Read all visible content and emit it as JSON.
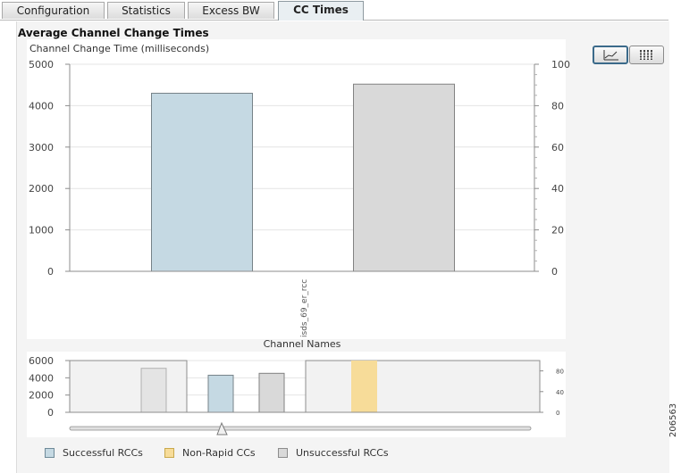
{
  "tabs": [
    {
      "label": "Configuration"
    },
    {
      "label": "Statistics"
    },
    {
      "label": "Excess BW"
    },
    {
      "label": "CC Times"
    }
  ],
  "page_title": "Average Channel Change Times",
  "view_toggle": {
    "icons": [
      "line-chart-icon",
      "column-chart-icon"
    ],
    "selected": "line-chart-icon"
  },
  "colors": {
    "successful": "#c5d9e3",
    "non_rapid": "#f7dc99",
    "unsuccessful": "#d9d9d9",
    "axis": "#8c8c8c"
  },
  "figure_number": "206563",
  "chart_data": [
    {
      "type": "bar",
      "ylabel": "Channel Change Time (milliseconds)",
      "xlabel": "Channel Names",
      "categories": [
        "isds_69_er_rcc"
      ],
      "series": [
        {
          "name": "Successful RCCs",
          "values": [
            4300
          ],
          "color": "#c5d9e3"
        },
        {
          "name": "Unsuccessful RCCs",
          "values": [
            4520
          ],
          "color": "#d9d9d9"
        }
      ],
      "ylim": [
        0,
        5000
      ],
      "yticks": [
        "0",
        "1000",
        "2000",
        "3000",
        "4000",
        "5000"
      ],
      "y2lim": [
        0,
        100
      ],
      "y2ticks": [
        "0",
        "20",
        "40",
        "60",
        "80",
        "100"
      ],
      "grid": true
    },
    {
      "type": "bar",
      "role": "overview navigator",
      "series": [
        {
          "name": "Unsuccessful RCCs",
          "values": [
            5100
          ],
          "color": "#d9d9d9"
        },
        {
          "name": "Successful RCCs",
          "values": [
            4300
          ],
          "color": "#c5d9e3"
        },
        {
          "name": "Unsuccessful RCCs",
          "values": [
            4520
          ],
          "color": "#d9d9d9"
        },
        {
          "name": "Non-Rapid CCs",
          "values": [
            100
          ],
          "color": "#f7dc99"
        }
      ],
      "ylim": [
        0,
        6000
      ],
      "yticks": [
        "0",
        "2000",
        "4000",
        "6000"
      ],
      "y2lim": [
        0,
        100
      ],
      "y2ticks": [
        "0",
        "40",
        "80"
      ]
    }
  ],
  "legend": [
    {
      "label": "Successful RCCs",
      "color": "#c5d9e3"
    },
    {
      "label": "Non-Rapid CCs",
      "color": "#f7dc99"
    },
    {
      "label": "Unsuccessful RCCs",
      "color": "#d9d9d9"
    }
  ]
}
